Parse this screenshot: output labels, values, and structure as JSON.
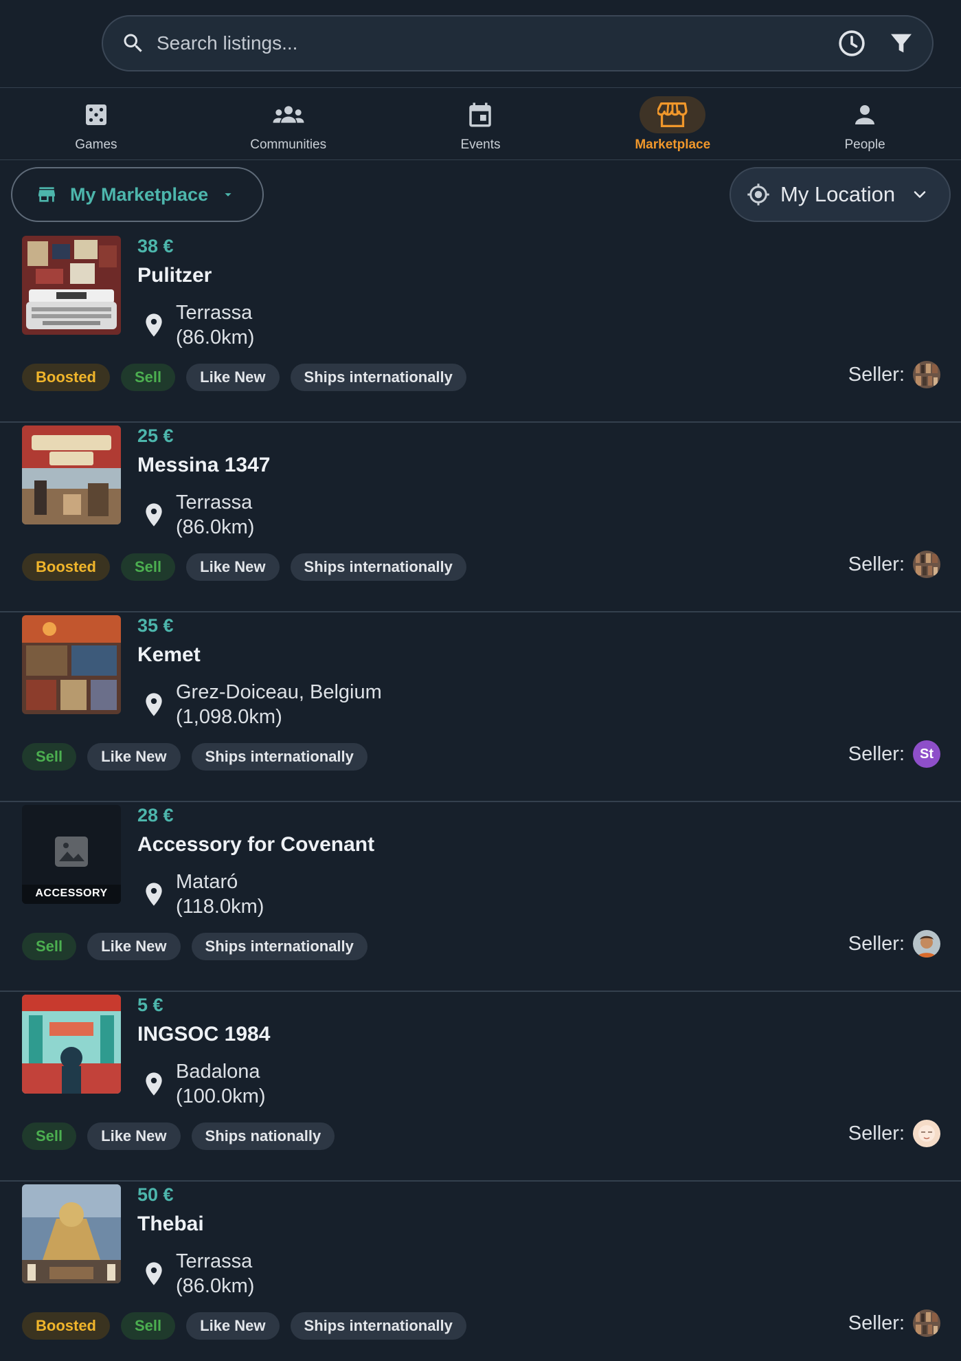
{
  "search": {
    "placeholder": "Search listings..."
  },
  "nav": {
    "items": [
      {
        "label": "Games",
        "icon": "dice-icon"
      },
      {
        "label": "Communities",
        "icon": "groups-icon"
      },
      {
        "label": "Events",
        "icon": "calendar-icon"
      },
      {
        "label": "Marketplace",
        "icon": "storefront-icon",
        "active": true
      },
      {
        "label": "People",
        "icon": "person-icon"
      }
    ]
  },
  "filters": {
    "marketplace_label": "My Marketplace",
    "location_label": "My Location"
  },
  "colors": {
    "accent_teal": "#4db6ac",
    "active_orange": "#f0972b",
    "boosted": "#f0b52b",
    "sell": "#4caf50"
  },
  "listings": [
    {
      "price": "38 €",
      "title": "Pulitzer",
      "city": "Terrassa",
      "distance": "(86.0km)",
      "boosted": "Boosted",
      "type": "Sell",
      "condition": "Like New",
      "shipping": "Ships internationally",
      "seller_label": "Seller:",
      "seller_avatar": "shelves-photo"
    },
    {
      "price": "25 €",
      "title": "Messina 1347",
      "city": "Terrassa",
      "distance": "(86.0km)",
      "boosted": "Boosted",
      "type": "Sell",
      "condition": "Like New",
      "shipping": "Ships internationally",
      "seller_label": "Seller:",
      "seller_avatar": "shelves-photo"
    },
    {
      "price": "35 €",
      "title": "Kemet",
      "city": "Grez-Doiceau, Belgium",
      "distance": "(1,098.0km)",
      "type": "Sell",
      "condition": "Like New",
      "shipping": "Ships internationally",
      "seller_label": "Seller:",
      "seller_avatar": "initials",
      "seller_initials": "St"
    },
    {
      "price": "28 €",
      "title": "Accessory for Covenant",
      "city": "Mataró",
      "distance": "(118.0km)",
      "type": "Sell",
      "condition": "Like New",
      "shipping": "Ships internationally",
      "seller_label": "Seller:",
      "seller_avatar": "portrait-photo",
      "thumb_caption": "ACCESSORY"
    },
    {
      "price": "5 €",
      "title": "INGSOC 1984",
      "city": "Badalona",
      "distance": "(100.0km)",
      "type": "Sell",
      "condition": "Like New",
      "shipping": "Ships nationally",
      "seller_label": "Seller:",
      "seller_avatar": "cartoon-photo"
    },
    {
      "price": "50 €",
      "title": "Thebai",
      "city": "Terrassa",
      "distance": "(86.0km)",
      "boosted": "Boosted",
      "type": "Sell",
      "condition": "Like New",
      "shipping": "Ships internationally",
      "seller_label": "Seller:",
      "seller_avatar": "shelves-photo"
    }
  ]
}
